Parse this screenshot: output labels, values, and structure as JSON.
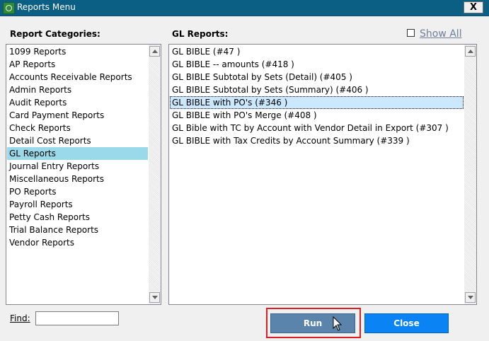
{
  "window": {
    "title": "Reports Menu",
    "close_glyph": "X"
  },
  "categories": {
    "label": "Report Categories:",
    "items": [
      "1099 Reports",
      "AP Reports",
      "Accounts Receivable Reports",
      "Admin Reports",
      "Audit Reports",
      "Card Payment Reports",
      "Check Reports",
      "Detail Cost Reports",
      "GL Reports",
      "Journal Entry Reports",
      "Miscellaneous Reports",
      "PO Reports",
      "Payroll Reports",
      "Petty Cash Reports",
      "Trial Balance Reports",
      "Vendor Reports"
    ],
    "selected": "GL Reports"
  },
  "reports": {
    "label": "GL Reports:",
    "items": [
      "GL BIBLE (#47 )",
      "GL BIBLE -- amounts (#418 )",
      "GL BIBLE Subtotal by Sets (Detail) (#405 )",
      "GL BIBLE Subtotal by Sets (Summary) (#406 )",
      "GL BIBLE with PO's (#346 )",
      "GL BIBLE with PO's Merge (#408 )",
      "GL Bible with TC by Account with Vendor Detail in Export (#307 )",
      "GL BIBLE with Tax Credits by Account Summary (#339 )"
    ],
    "selected": "GL BIBLE with PO's (#346 )"
  },
  "show_all": {
    "label": "Show All",
    "checked": false
  },
  "find": {
    "label": "Find:",
    "value": ""
  },
  "buttons": {
    "run": "Run",
    "close": "Close"
  },
  "colors": {
    "titlebar": "#0b5e84",
    "category_selected": "#99d9ea",
    "report_selected": "#cce8ff",
    "run_button": "#5b84ad",
    "close_button": "#0a84f5",
    "highlight": "#e02020"
  },
  "icons": {
    "app": "app-logo-icon",
    "cursor": "mouse-pointer-icon",
    "scroll_up": "scroll-up-arrow-icon",
    "scroll_down": "scroll-down-arrow-icon"
  }
}
